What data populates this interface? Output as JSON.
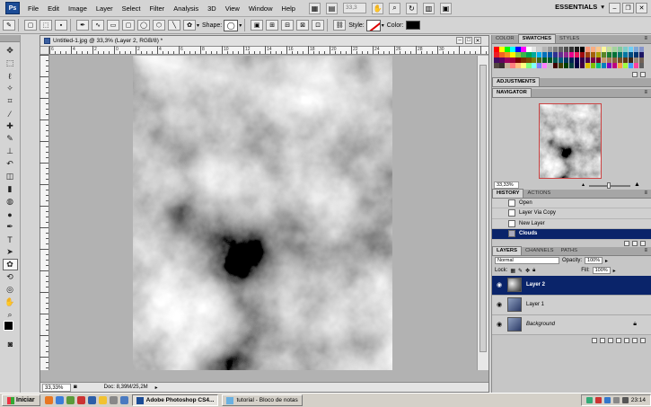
{
  "menubar": {
    "logo": "Ps",
    "items": [
      "File",
      "Edit",
      "Image",
      "Layer",
      "Select",
      "Filter",
      "Analysis",
      "3D",
      "View",
      "Window",
      "Help"
    ],
    "zoom_value": "33,3",
    "workspace": "ESSENTIALS"
  },
  "options": {
    "shape_label": "Shape:",
    "style_label": "Style:",
    "color_label": "Color:",
    "color": "#000000"
  },
  "document": {
    "title": "Untitled-1.jpg @ 33,3% (Layer 2, RGB/8) *",
    "status_zoom": "33,33%",
    "status_doc": "Doc: 8,39M/25,2M",
    "ruler_numbers": [
      "6",
      "4",
      "2",
      "0",
      "2",
      "4",
      "6",
      "8",
      "10",
      "12",
      "14",
      "16",
      "18",
      "20",
      "22",
      "24",
      "26",
      "28",
      "30"
    ]
  },
  "panels": {
    "color_tabs": [
      "COLOR",
      "SWATCHES",
      "STYLES"
    ],
    "adjustments_tab": "ADJUSTMENTS",
    "navigator_tab": "NAVIGATOR",
    "navigator_zoom": "33,33%",
    "history_tabs": [
      "HISTORY",
      "ACTIONS"
    ],
    "history_items": [
      "Open",
      "Layer Via Copy",
      "New Layer",
      "Clouds"
    ],
    "layers_tabs": [
      "LAYERS",
      "CHANNELS",
      "PATHS"
    ],
    "blend_mode": "Normal",
    "opacity_label": "Opacity:",
    "opacity_value": "100%",
    "lock_label": "Lock:",
    "fill_label": "Fill:",
    "fill_value": "100%",
    "layers": [
      "Layer 2",
      "Layer 1",
      "Background"
    ]
  },
  "taskbar": {
    "start": "Iniciar",
    "tasks": [
      "Adobe Photoshop CS4...",
      "tutorial - Bloco de notas"
    ],
    "clock": "23:14"
  },
  "colors": {
    "selection": "#0a246a",
    "brand": "#1c4c96"
  }
}
